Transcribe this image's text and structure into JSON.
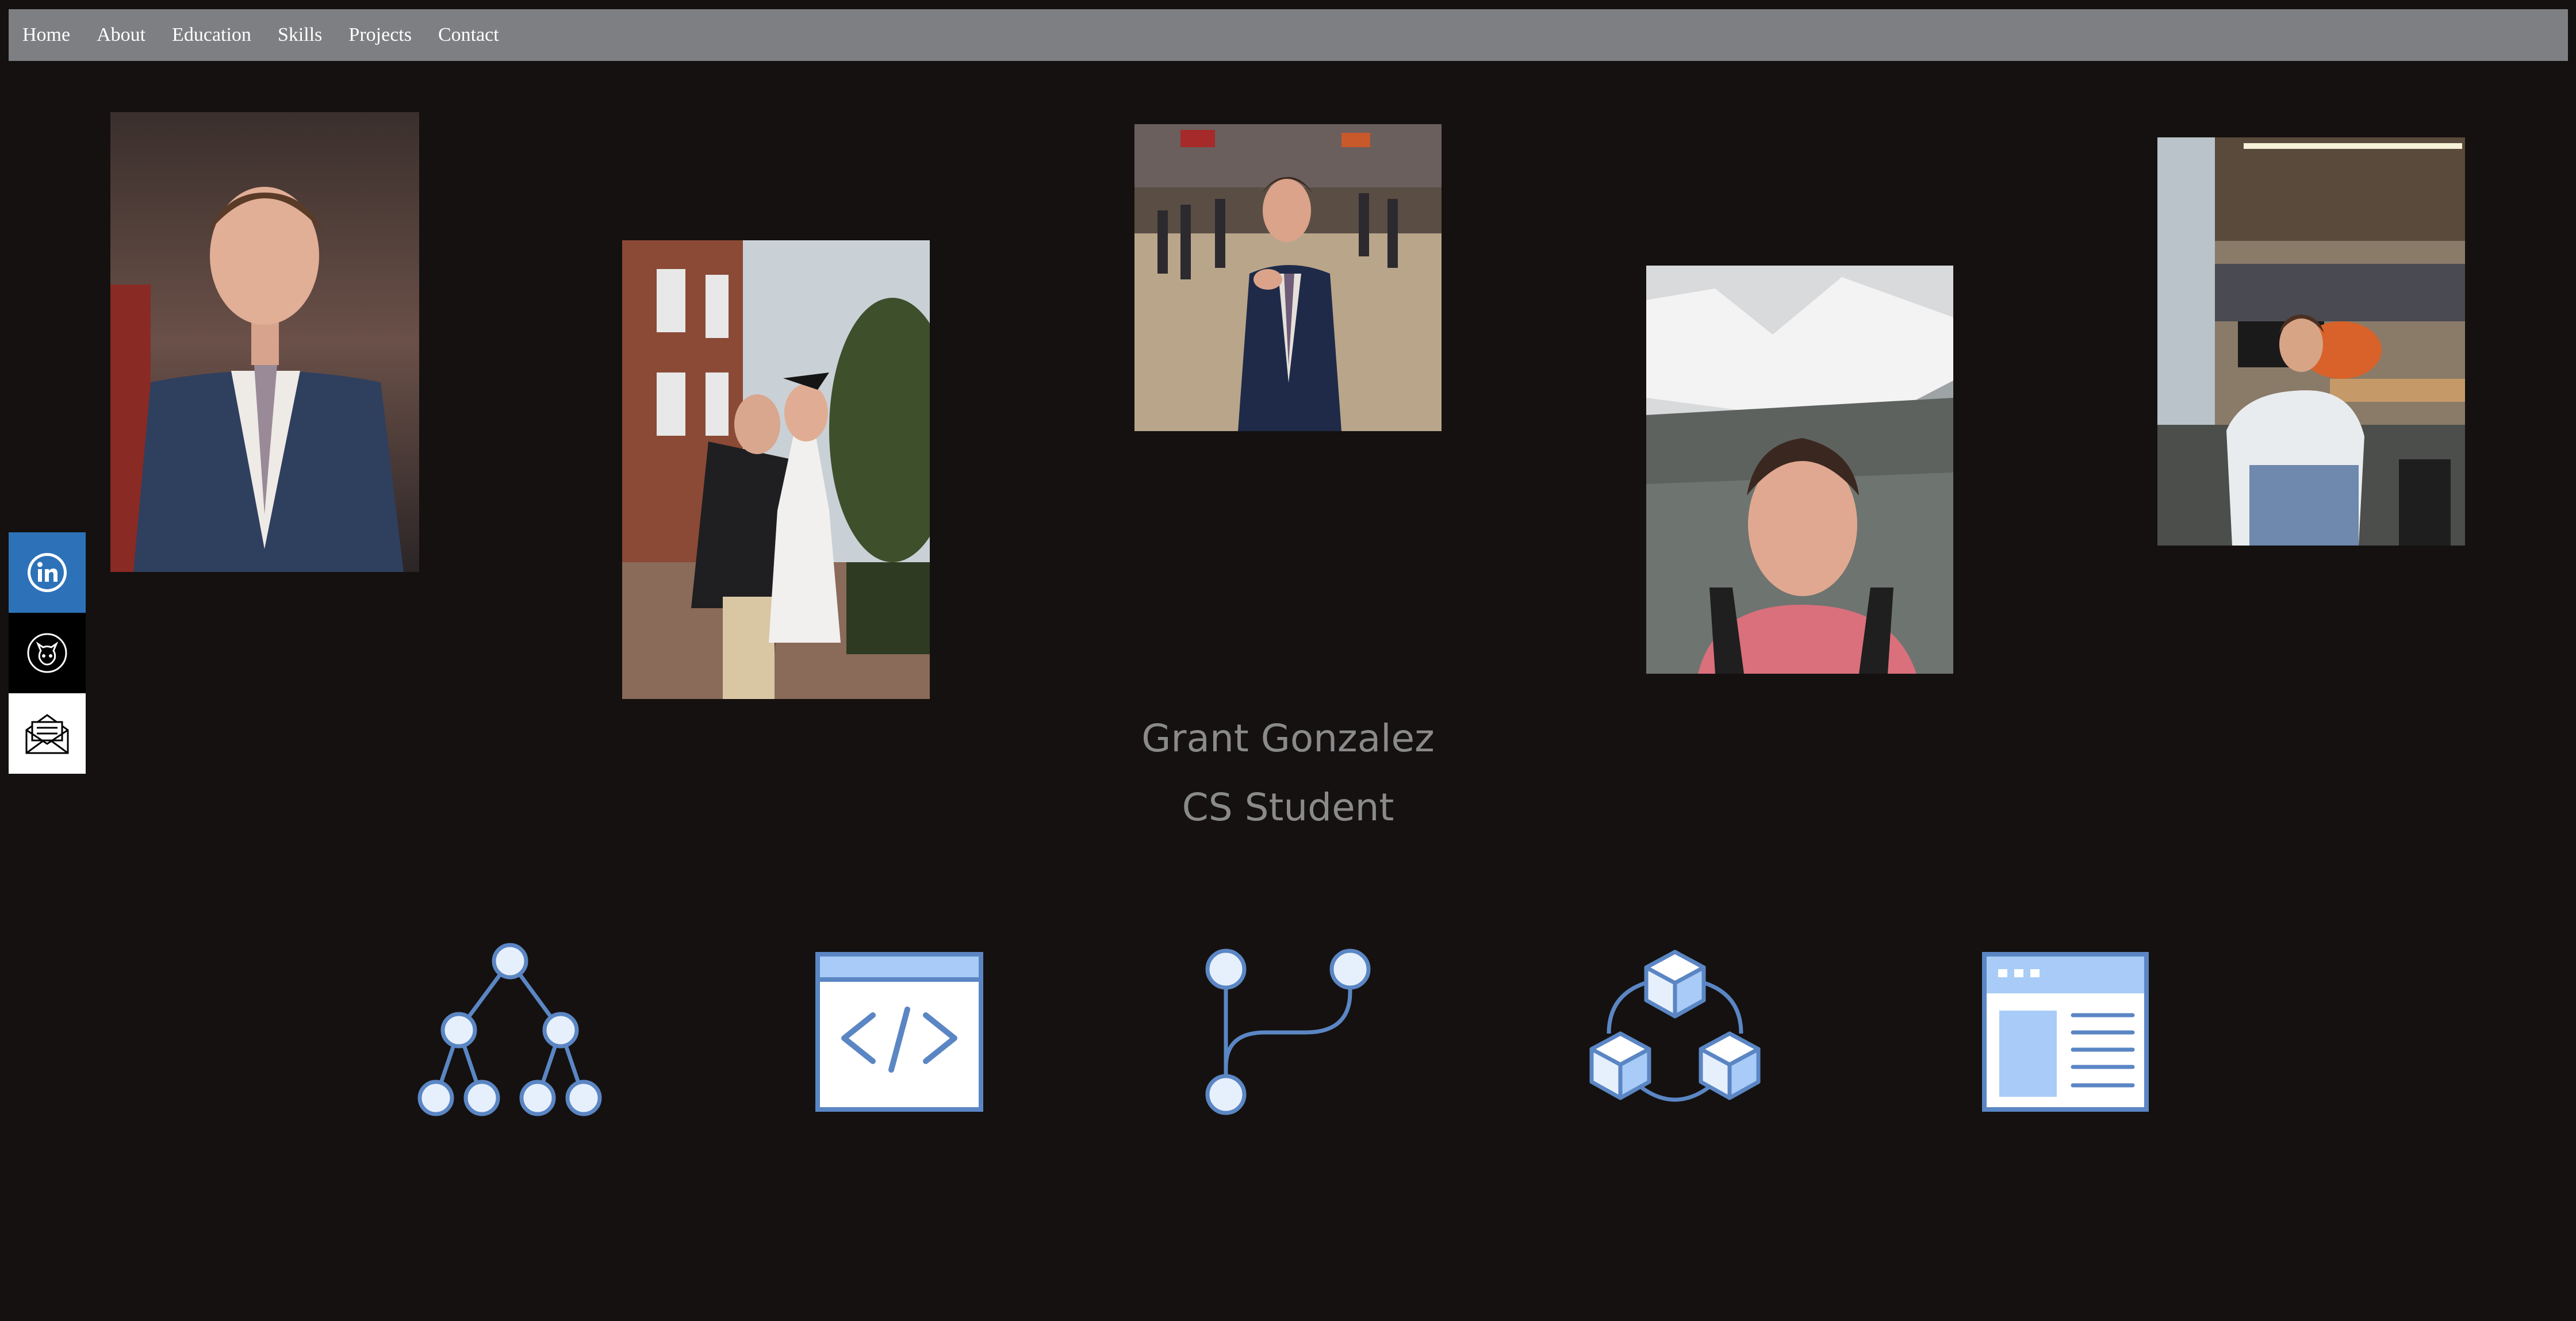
{
  "nav": {
    "items": [
      {
        "label": "Home"
      },
      {
        "label": "About"
      },
      {
        "label": "Education"
      },
      {
        "label": "Skills"
      },
      {
        "label": "Projects"
      },
      {
        "label": "Contact"
      }
    ]
  },
  "photos": [
    {
      "icon": "portrait-photo"
    },
    {
      "icon": "graduation-couple-photo"
    },
    {
      "icon": "ring-ceremony-photo"
    },
    {
      "icon": "mountain-selfie-photo"
    },
    {
      "icon": "office-photo"
    }
  ],
  "social": [
    {
      "icon": "linkedin-icon",
      "color": "#2d72b8"
    },
    {
      "icon": "github-icon",
      "color": "#000000"
    },
    {
      "icon": "mail-icon",
      "color": "#ffffff"
    }
  ],
  "hero": {
    "name": "Grant Gonzalez",
    "role": "CS Student"
  },
  "skills": [
    {
      "icon": "tree-structure-icon"
    },
    {
      "icon": "code-window-icon"
    },
    {
      "icon": "git-branch-icon"
    },
    {
      "icon": "cubes-network-icon"
    },
    {
      "icon": "web-page-icon"
    }
  ],
  "colors": {
    "background": "#141110",
    "navbar": "#7e7f82",
    "hero_text": "#8a8a8a",
    "icon_stroke": "#5b86c4",
    "icon_fill": "#a8ccf7"
  }
}
